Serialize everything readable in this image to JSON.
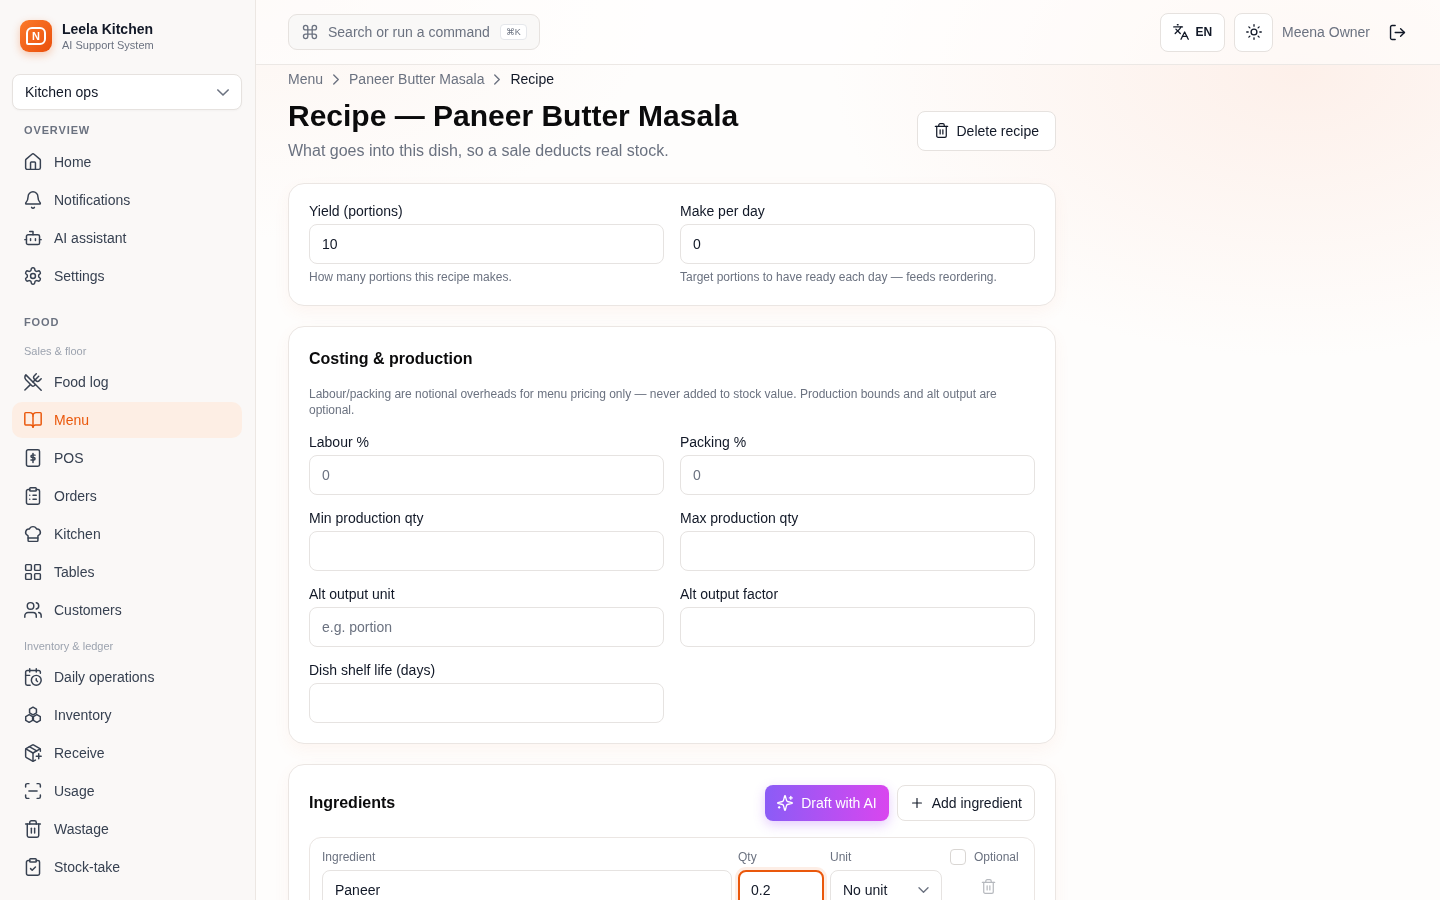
{
  "brand": {
    "mark": "N",
    "name": "Leela Kitchen",
    "tagline": "AI Support System"
  },
  "sidebar": {
    "workspace": {
      "value": "Kitchen ops"
    },
    "sections": [
      {
        "heading": "OVERVIEW",
        "groups": [
          {
            "items": [
              {
                "label": "Home",
                "selected": false
              },
              {
                "label": "Notifications",
                "selected": false
              },
              {
                "label": "AI assistant",
                "selected": false
              },
              {
                "label": "Settings",
                "selected": false
              }
            ]
          }
        ]
      },
      {
        "heading": "FOOD",
        "groups": [
          {
            "label": "Sales & floor",
            "items": [
              {
                "label": "Food log",
                "selected": false
              },
              {
                "label": "Menu",
                "selected": true
              },
              {
                "label": "POS",
                "selected": false
              },
              {
                "label": "Orders",
                "selected": false
              },
              {
                "label": "Kitchen",
                "selected": false
              },
              {
                "label": "Tables",
                "selected": false
              },
              {
                "label": "Customers",
                "selected": false
              }
            ]
          },
          {
            "label": "Inventory & ledger",
            "items": [
              {
                "label": "Daily operations",
                "selected": false
              },
              {
                "label": "Inventory",
                "selected": false
              },
              {
                "label": "Receive",
                "selected": false
              },
              {
                "label": "Usage",
                "selected": false
              },
              {
                "label": "Wastage",
                "selected": false
              },
              {
                "label": "Stock-take",
                "selected": false
              }
            ]
          }
        ]
      }
    ]
  },
  "topbar": {
    "search": {
      "label": "Search or run a command",
      "shortcut": "⌘K"
    },
    "language": {
      "code": "EN"
    },
    "user": {
      "name": "Meena Owner"
    }
  },
  "breadcrumb": [
    {
      "label": "Menu",
      "current": false
    },
    {
      "label": "Paneer Butter Masala",
      "current": false
    },
    {
      "label": "Recipe",
      "current": true
    }
  ],
  "header": {
    "title": "Recipe — Paneer Butter Masala",
    "subtitle": "What goes into this dish, so a sale deducts real stock.",
    "delete_button": "Delete recipe"
  },
  "yield_card": {
    "fields": [
      {
        "label": "Yield (portions)",
        "value": "10",
        "help": "How many portions this recipe makes."
      },
      {
        "label": "Make per day",
        "value": "0",
        "help": "Target portions to have ready each day — feeds reordering."
      }
    ]
  },
  "costing_card": {
    "title": "Costing & production",
    "description": "Labour/packing are notional overheads for menu pricing only — never added to stock value. Production bounds and alt output are optional.",
    "fields": [
      {
        "label": "Labour %",
        "placeholder": "0"
      },
      {
        "label": "Packing %",
        "placeholder": "0"
      },
      {
        "label": "Min production qty"
      },
      {
        "label": "Max production qty"
      },
      {
        "label": "Alt output unit",
        "placeholder": "e.g. portion"
      },
      {
        "label": "Alt output factor"
      },
      {
        "label": "Dish shelf life (days)"
      }
    ]
  },
  "ingredients_card": {
    "title": "Ingredients",
    "draft_button": "Draft with AI",
    "add_button": "Add ingredient",
    "rows": [
      {
        "fields": [
          {
            "kind": "text",
            "label": "Ingredient",
            "value": "Paneer",
            "focused": false
          },
          {
            "kind": "text",
            "label": "Qty",
            "value": "0.2",
            "focused": true
          },
          {
            "kind": "select",
            "label": "Unit",
            "value": "No unit",
            "focused": false
          }
        ],
        "optional": {
          "label": "Optional",
          "checked": false
        }
      }
    ]
  }
}
